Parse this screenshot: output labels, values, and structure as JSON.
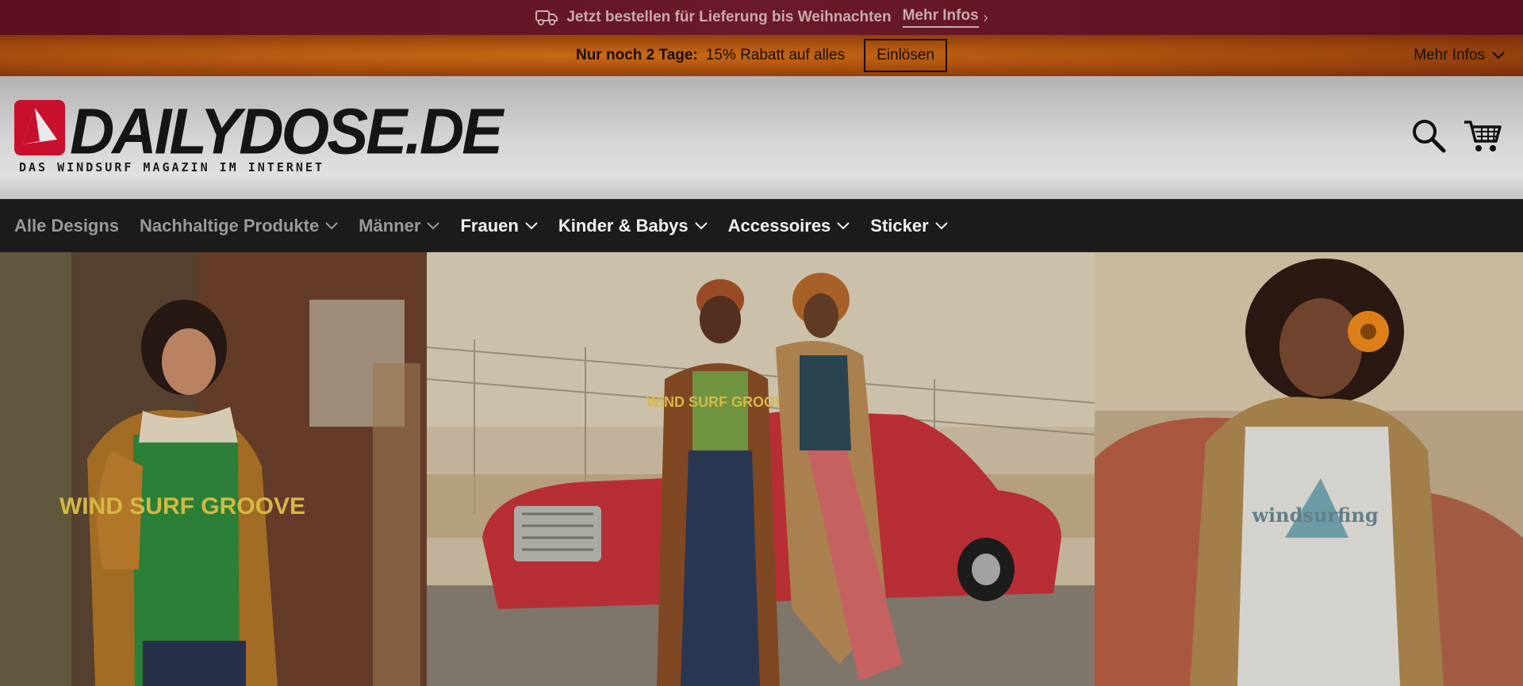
{
  "topbar": {
    "message": "Jetzt bestellen für Lieferung bis Weihnachten",
    "link": "Mehr Infos",
    "icon": "truck-icon"
  },
  "promo": {
    "lead": "Nur noch 2 Tage:",
    "offer": "15% Rabatt auf alles",
    "button": "Einlösen",
    "right_link": "Mehr Infos"
  },
  "header": {
    "logo_word": "DAILYDOSE.DE",
    "logo_tag": "DAS WINDSURF MAGAZIN IM INTERNET",
    "icons": [
      "search-icon",
      "cart-icon"
    ]
  },
  "nav": {
    "items": [
      {
        "label": "Alle Designs"
      },
      {
        "label": "Nachhaltige Produkte"
      },
      {
        "label": "Männer"
      },
      {
        "label": "Frauen"
      },
      {
        "label": "Kinder & Babys"
      },
      {
        "label": "Accessoires"
      },
      {
        "label": "Sticker"
      }
    ]
  },
  "hero": {
    "panels": [
      {
        "shirt_text": "WIND SURF GROOVE"
      },
      {
        "shirt_text": "WIND SURF GROOVE"
      },
      {
        "shirt_text": "windsurfing"
      }
    ]
  },
  "colors": {
    "topbar": "#5b0f1f",
    "promobar": "#c96a1a",
    "nav": "#1b1b1b",
    "logo_red": "#c8102e"
  }
}
